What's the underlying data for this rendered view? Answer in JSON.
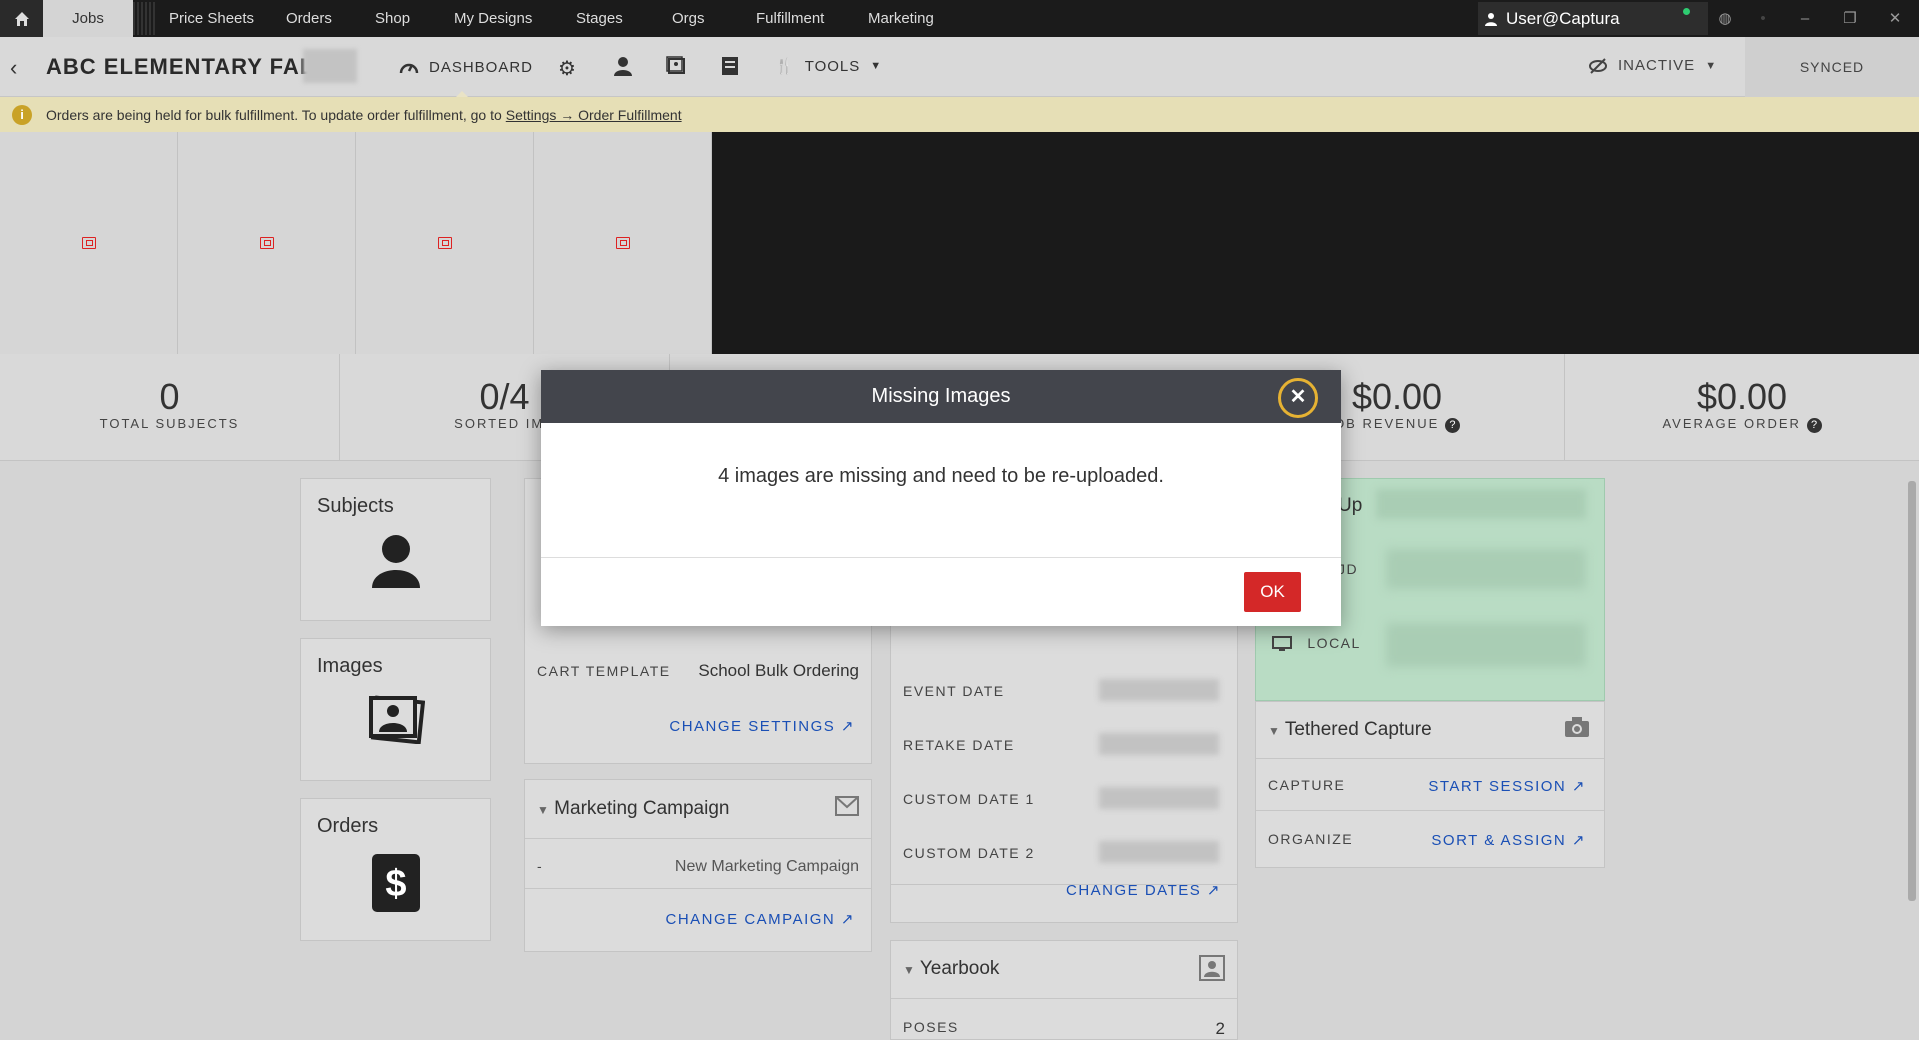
{
  "topnav": {
    "tabs": [
      "Jobs",
      "Price Sheets",
      "Orders",
      "Shop",
      "My Designs",
      "Stages",
      "Orgs",
      "Fulfillment",
      "Marketing"
    ],
    "user": "User@Captura"
  },
  "subheader": {
    "job_title": "ABC ELEMENTARY FALL",
    "dashboard_label": "DASHBOARD",
    "tools_label": "TOOLS",
    "status_label": "INACTIVE",
    "sync_label": "SYNCED"
  },
  "alert": {
    "text": "Orders are being held for bulk fulfillment. To update order fulfillment, go to",
    "link": "Settings → Order Fulfillment"
  },
  "stats": [
    {
      "value": "0",
      "label": "TOTAL SUBJECTS"
    },
    {
      "value": "0/4",
      "label": "SORTED IMA"
    },
    {
      "value": "$0.00",
      "label": "OB REVENUE"
    },
    {
      "value": "$0.00",
      "label": "AVERAGE ORDER"
    }
  ],
  "nav_cards": {
    "subjects": "Subjects",
    "images": "Images",
    "orders": "Orders"
  },
  "settings_card": {
    "cart_template_label": "CART TEMPLATE",
    "cart_template_value": "School Bulk Ordering",
    "change_settings": "CHANGE SETTINGS"
  },
  "marketing_card": {
    "title": "Marketing Campaign",
    "dash": "-",
    "campaign": "New Marketing Campaign",
    "change_campaign": "CHANGE CAMPAIGN"
  },
  "dates_card": {
    "event_date": "EVENT DATE",
    "retake_date": "RETAKE DATE",
    "custom_date_1": "CUSTOM DATE 1",
    "custom_date_2": "CUSTOM DATE 2",
    "change_dates": "CHANGE DATES"
  },
  "yearbook_card": {
    "title": "Yearbook",
    "poses_label": "POSES",
    "poses_value": "2"
  },
  "upload_card": {
    "title_partial": "Up",
    "cloud_partial": "JD",
    "local_label": "LOCAL"
  },
  "tethered_card": {
    "title": "Tethered Capture",
    "capture_label": "CAPTURE",
    "start_session": "START SESSION",
    "organize_label": "ORGANIZE",
    "sort_assign": "SORT & ASSIGN"
  },
  "modal": {
    "title": "Missing Images",
    "message": "4 images are missing and need to be re-uploaded.",
    "ok_label": "OK"
  },
  "colors": {
    "accent_red": "#d42828",
    "link_blue": "#1a4fb5",
    "alert_bg": "#e6dfb6",
    "upload_green": "#b9dcc4"
  }
}
